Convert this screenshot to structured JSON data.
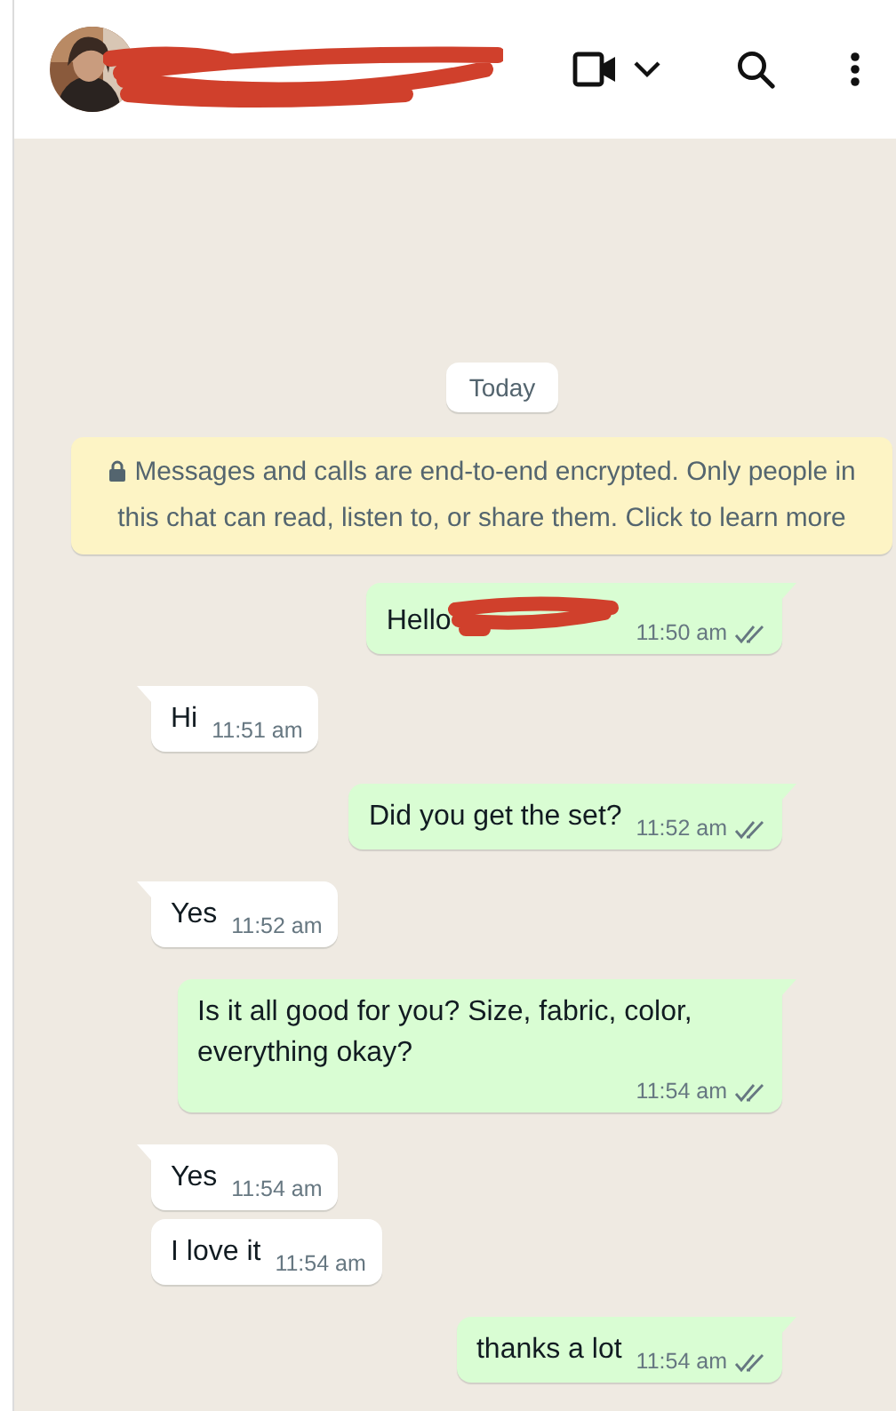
{
  "header": {
    "contact": {
      "redacted": true
    }
  },
  "date_divider": "Today",
  "encryption_notice": "Messages and calls are end-to-end encrypted. Only people in this chat can read, listen to, or share them. Click to learn more",
  "messages": [
    {
      "kind": "outgoing",
      "text": "Hello",
      "redacted": true,
      "time": "11:50 am",
      "read": false
    },
    {
      "kind": "incoming",
      "text": "Hi",
      "time": "11:51 am"
    },
    {
      "kind": "outgoing",
      "text": "Did you get the set?",
      "time": "11:52 am",
      "read": false
    },
    {
      "kind": "incoming",
      "text": "Yes",
      "time": "11:52 am"
    },
    {
      "kind": "outgoing",
      "text": "Is it all good for you? Size, fabric, color, everything okay?",
      "time": "11:54 am",
      "read": false
    },
    {
      "kind": "incoming",
      "text": "Yes",
      "time": "11:54 am"
    },
    {
      "kind": "incoming",
      "text": "I love it",
      "time": "11:54 am"
    },
    {
      "kind": "outgoing",
      "text": "thanks a lot",
      "time": "11:54 am",
      "read": false
    }
  ]
}
